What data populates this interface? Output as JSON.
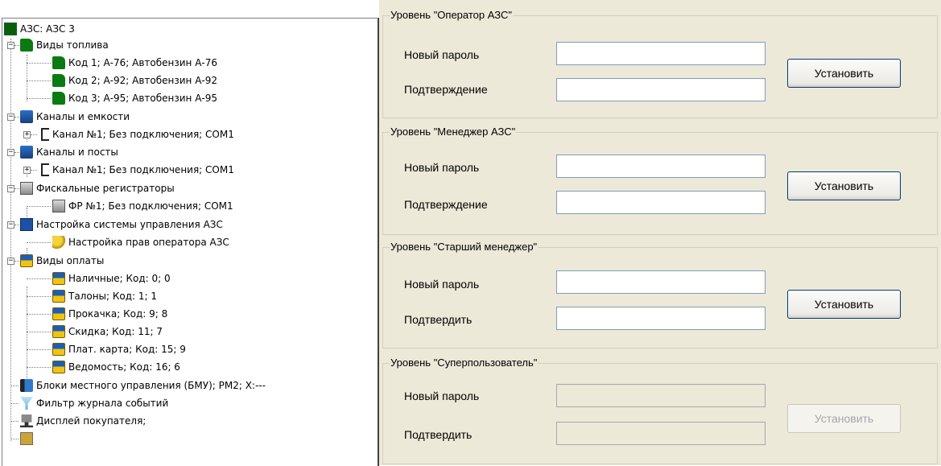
{
  "tree": {
    "root": "АЗС: АЗС 3",
    "fuel_types": "Виды топлива",
    "fuels": [
      "Код 1; А-76; Автобензин А-76",
      "Код 2; А-92; Автобензин А-92",
      "Код 3; А-95; Автобензин А-95"
    ],
    "channels_tanks": "Каналы и емкости",
    "channels_tanks_item": "Канал №1; Без подключения; COM1",
    "channels_posts": "Каналы и посты",
    "channels_posts_item": "Канал №1; Без подключения; COM1",
    "fiscal": "Фискальные регистраторы",
    "fiscal_item": "ФР №1; Без подключения; COM1",
    "mgmt": "Настройка системы управления АЗС",
    "mgmt_item": "Настройка прав оператора АЗС",
    "payment_types": "Виды оплаты",
    "payments": [
      "Наличные; Код: 0; 0",
      "Талоны; Код: 1; 1",
      "Прокачка; Код: 9; 8",
      "Скидка; Код: 11; 7",
      "Плат. карта; Код: 15; 9",
      "Ведомость; Код: 16; 6"
    ],
    "bmu": "Блоки местного управления (БМУ);  РМ2;  X:---",
    "event_filter": "Фильтр журнала событий",
    "customer_display": "Дисплей покупателя;"
  },
  "levels": [
    {
      "title": "Уровень \"Оператор АЗС\"",
      "pwd_label": "Новый пароль",
      "confirm_label": "Подтверждение",
      "button": "Установить",
      "enabled": true
    },
    {
      "title": "Уровень \"Менеджер АЗС\"",
      "pwd_label": "Новый пароль",
      "confirm_label": "Подтверждение",
      "button": "Установить",
      "enabled": true
    },
    {
      "title": "Уровень \"Старший менеджер\"",
      "pwd_label": "Новый пароль",
      "confirm_label": "Подтвердить",
      "button": "Установить",
      "enabled": true
    },
    {
      "title": "Уровень \"Суперпользователь\"",
      "pwd_label": "Новый пароль",
      "confirm_label": "Подтвердить",
      "button": "Установить",
      "enabled": false
    }
  ]
}
